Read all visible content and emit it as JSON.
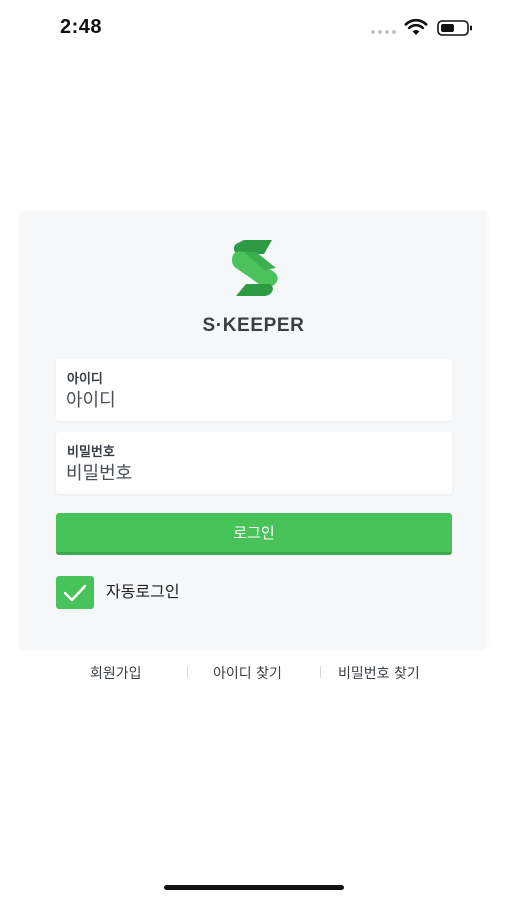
{
  "status_bar": {
    "time": "2:48",
    "icons": [
      "signal-dots",
      "wifi-icon",
      "battery-icon"
    ]
  },
  "brand": {
    "name": "S·KEEPER",
    "logo_icon": "s-logo-icon",
    "accent_color": "#48c35a"
  },
  "form": {
    "id_label": "아이디",
    "id_placeholder": "아이디",
    "id_value": "",
    "password_label": "비밀번호",
    "password_placeholder": "비밀번호",
    "password_value": "",
    "login_button": "로그인",
    "auto_login_label": "자동로그인",
    "auto_login_checked": true
  },
  "footer": {
    "signup": "회원가입",
    "find_id": "아이디 찾기",
    "find_password": "비밀번호 찾기"
  },
  "colors": {
    "card_background": "#f5f7f9",
    "button_green": "#48c35a",
    "text_dark": "#3a3f44"
  }
}
